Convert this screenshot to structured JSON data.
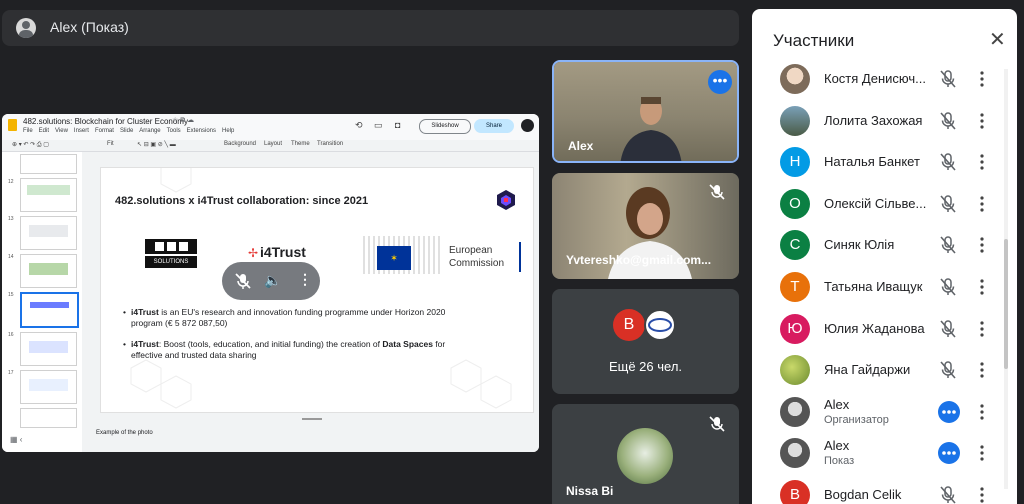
{
  "presenter_bar": {
    "name": "Alex (Показ)"
  },
  "slides_app": {
    "doc_title": "482.solutions: Blockchain for Cluster Economy",
    "menu": [
      "File",
      "Edit",
      "View",
      "Insert",
      "Format",
      "Slide",
      "Arrange",
      "Tools",
      "Extensions",
      "Help"
    ],
    "slideshow_label": "Slideshow",
    "share_label": "Share",
    "toolbar": {
      "fit": "Fit",
      "background": "Background",
      "layout": "Layout",
      "theme": "Theme",
      "transition": "Transition"
    },
    "thumb_numbers": [
      "12",
      "13",
      "14",
      "15",
      "16",
      "17"
    ],
    "speaker_notes": "Example of the photo"
  },
  "slide": {
    "title": "482.solutions x i4Trust collaboration: since 2021",
    "logo_solutions": "SOLUTIONS",
    "logo_i4trust": "i4Trust",
    "logo_ec_line1": "European",
    "logo_ec_line2": "Commission",
    "bullet1_bold": "i4Trust",
    "bullet1_text": " is an EU's research and innovation funding programme under Horizon 2020",
    "bullet1_text2": "program (€ 5 872 087,50)",
    "bullet2_bold": "i4Trust",
    "bullet2_text": ": Boost (tools, education, and initial funding) the creation of ",
    "bullet2_bold2": "Data Spaces",
    "bullet2_text2": " for",
    "bullet2_text3": "effective and trusted data sharing"
  },
  "tiles": {
    "alex": "Alex",
    "yvtereshko": "Yvtereshko@gmail.com...",
    "more_people": "Ещё 26 чел.",
    "more_avatar_letter": "B",
    "nissa": "Nissa Bi"
  },
  "panel": {
    "title": "Участники",
    "participants": [
      {
        "name": "Костя Денисюч...",
        "role": "",
        "letter": "",
        "color": ""
      },
      {
        "name": "Лолита Захожая",
        "role": "",
        "letter": "",
        "color": ""
      },
      {
        "name": "Наталья Банкет",
        "role": "",
        "letter": "Н",
        "color": "#039be5"
      },
      {
        "name": "Олексій Сільве...",
        "role": "",
        "letter": "О",
        "color": "#0b8043"
      },
      {
        "name": "Синяк Юлія",
        "role": "",
        "letter": "С",
        "color": "#0b8043"
      },
      {
        "name": "Татьяна Иващук",
        "role": "",
        "letter": "Т",
        "color": "#e8710a"
      },
      {
        "name": "Юлия Жаданова",
        "role": "",
        "letter": "Ю",
        "color": "#d81b60"
      },
      {
        "name": "Яна Гайдаржи",
        "role": "",
        "letter": "",
        "color": ""
      },
      {
        "name": "Alex",
        "role": "Организатор",
        "letter": "",
        "color": ""
      },
      {
        "name": "Alex",
        "role": "Показ",
        "letter": "",
        "color": ""
      },
      {
        "name": "Bogdan Celik",
        "role": "",
        "letter": "B",
        "color": "#d93025"
      }
    ]
  }
}
